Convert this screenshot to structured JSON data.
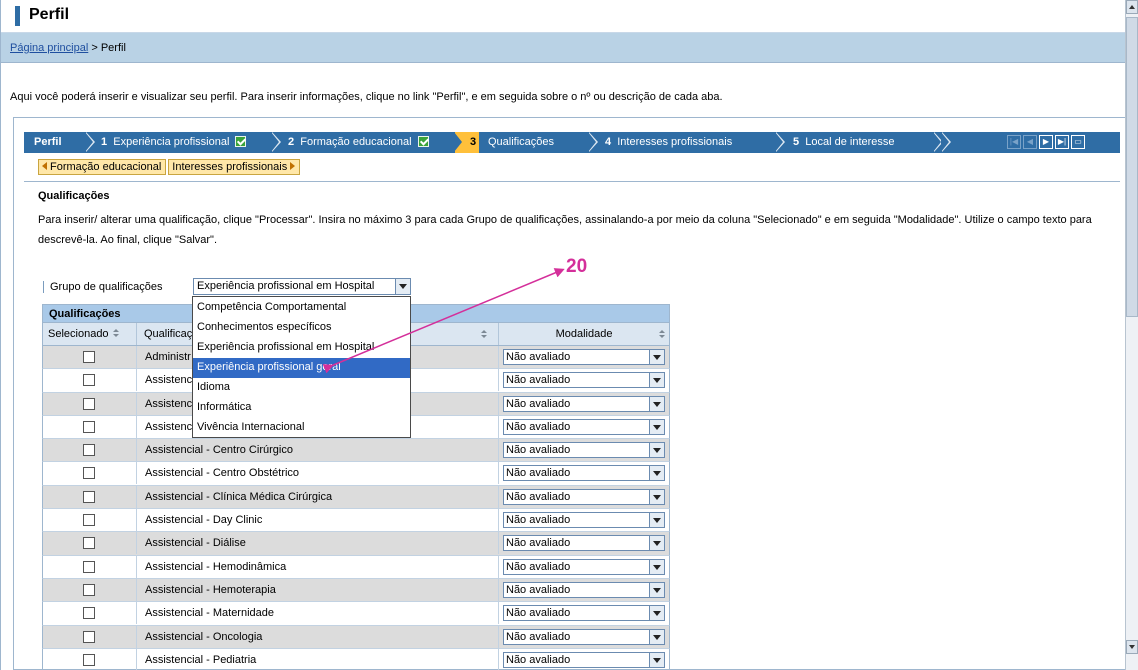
{
  "page": {
    "title": "Perfil",
    "breadcrumb_link": "Página principal",
    "breadcrumb_current": "> Perfil",
    "intro": "Aqui você poderá inserir e visualizar seu perfil. Para inserir informações, clique no link \"Perfil\", e em seguida sobre o nº ou descrição de cada aba."
  },
  "roadmap": {
    "root": "Perfil",
    "steps": [
      {
        "num": "1",
        "label": "Experiência profissional",
        "done": true
      },
      {
        "num": "2",
        "label": "Formação educacional",
        "done": true
      },
      {
        "num": "3",
        "label": "Qualificações",
        "active": true
      },
      {
        "num": "4",
        "label": "Interesses profissionais"
      },
      {
        "num": "5",
        "label": "Local de interesse"
      }
    ]
  },
  "subnav": {
    "prev": "Formação educacional",
    "next": "Interesses profissionais"
  },
  "section": {
    "title": "Qualificações",
    "instructions": "Para inserir/ alterar uma qualificação, clique \"Processar\". Insira no máximo 3 para cada Grupo de qualificações, assinalando-a por meio da coluna \"Selecionado\" e em seguida \"Modalidade\". Utilize o campo texto para descrevê-la. Ao final, clique \"Salvar\"."
  },
  "group": {
    "label": "Grupo de qualificações",
    "value": "Experiência profissional em Hospital",
    "options": [
      "Competência Comportamental",
      "Conhecimentos específicos",
      "Experiência profissional em Hospital",
      "Experiência profissional geral",
      "Idioma",
      "Informática",
      "Vivência Internacional"
    ],
    "highlighted_index": 3
  },
  "table": {
    "title": "Qualificações",
    "headers": {
      "selected": "Selecionado",
      "qualification": "Qualificaç",
      "modality": "Modalidade"
    },
    "rows": [
      {
        "name": "Administr",
        "modality": "Não avaliado"
      },
      {
        "name": "Assistenc",
        "modality": "Não avaliado"
      },
      {
        "name": "Assistenc",
        "modality": "Não avaliado"
      },
      {
        "name": "Assistenc",
        "modality": "Não avaliado"
      },
      {
        "name": "Assistencial - Centro Cirúrgico",
        "modality": "Não avaliado"
      },
      {
        "name": "Assistencial - Centro Obstétrico",
        "modality": "Não avaliado"
      },
      {
        "name": "Assistencial - Clínica Médica Cirúrgica",
        "modality": "Não avaliado"
      },
      {
        "name": "Assistencial - Day Clinic",
        "modality": "Não avaliado"
      },
      {
        "name": "Assistencial - Diálise",
        "modality": "Não avaliado"
      },
      {
        "name": "Assistencial - Hemodinâmica",
        "modality": "Não avaliado"
      },
      {
        "name": "Assistencial - Hemoterapia",
        "modality": "Não avaliado"
      },
      {
        "name": "Assistencial - Maternidade",
        "modality": "Não avaliado"
      },
      {
        "name": "Assistencial - Oncologia",
        "modality": "Não avaliado"
      },
      {
        "name": "Assistencial - Pediatria",
        "modality": "Não avaliado"
      }
    ]
  },
  "annotation": {
    "number": "20",
    "color": "#d42f9a"
  },
  "colors": {
    "accent": "#2f6da5",
    "active_step": "#ffc03b",
    "highlight": "#316ac5"
  }
}
